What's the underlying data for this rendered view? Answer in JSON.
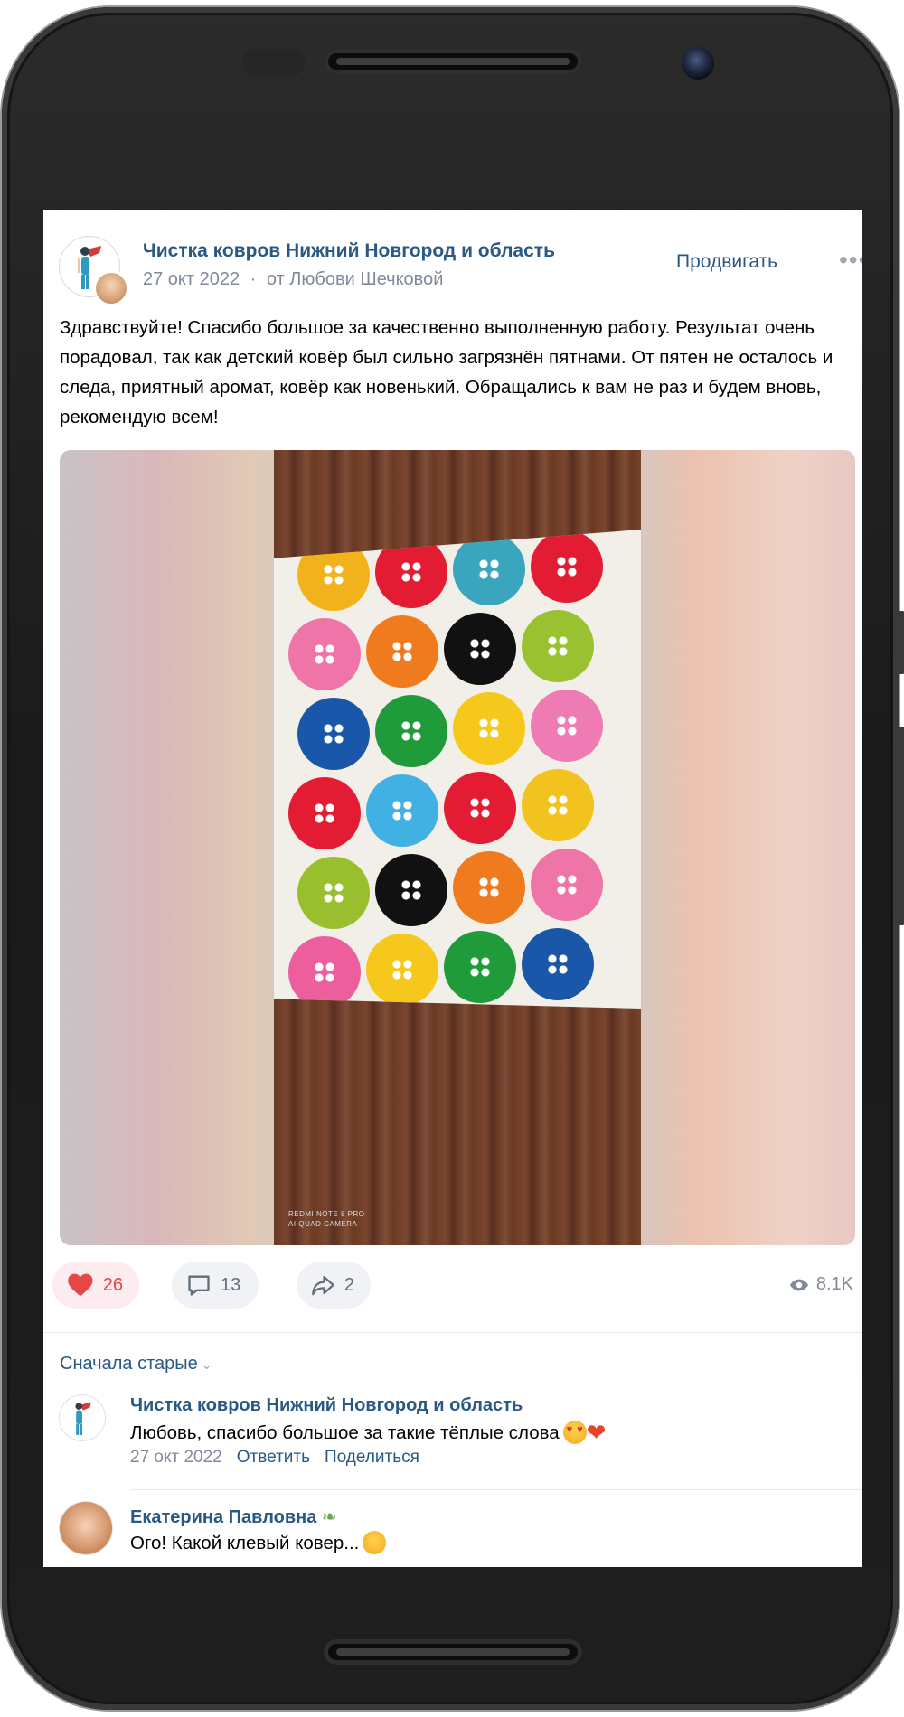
{
  "post": {
    "group_name": "Чистка ковров Нижний Новгород и область",
    "date": "27 окт 2022",
    "separator": "·",
    "author_line": "от Любови Шечковой",
    "promote_label": "Продвигать",
    "more_label": "•••",
    "text": "Здравствуйте! Спасибо большое за качественно выполненную работу. Результат очень порадовал, так как детский ковёр был сильно загрязнён пятнами. От пятен не осталось и следа, приятный аромат, ковёр как новенький. Обращались к вам не раз и будем вновь, рекомендую всем!",
    "photo_watermark_line1": "REDMI NOTE 8 PRO",
    "photo_watermark_line2": "AI QUAD CAMERA"
  },
  "actions": {
    "likes": "26",
    "comments": "13",
    "shares": "2",
    "views": "8.1K",
    "like_color": "#e64646"
  },
  "comments_section": {
    "sort_label": "Сначала старые",
    "items": [
      {
        "author": "Чистка ковров Нижний Новгород и область",
        "text": "Любовь, спасибо большое за такие тёплые слова",
        "date": "27 окт 2022",
        "reply_label": "Ответить",
        "share_label": "Поделиться"
      },
      {
        "author": "Екатерина Павловна",
        "text": "Ого! Какой клевый ковер..."
      }
    ]
  },
  "rug_colors": [
    "#f2b21c",
    "#e31b33",
    "#3aa6be",
    "#e31b33",
    "#ef74a8",
    "#f07a1e",
    "#111111",
    "#9ac12f",
    "#1a57a8",
    "#1f9b3a",
    "#f6c81d",
    "#ee7bb3",
    "#e31b33",
    "#41b1e3",
    "#e31b33",
    "#f2c31f",
    "#99be2e",
    "#111111",
    "#f07a1e",
    "#ef74a8",
    "#ec5e9c",
    "#f6c81d",
    "#1f9b3a",
    "#1a57a8"
  ],
  "colors": {
    "link": "#2a5885",
    "meta": "#828a99"
  }
}
